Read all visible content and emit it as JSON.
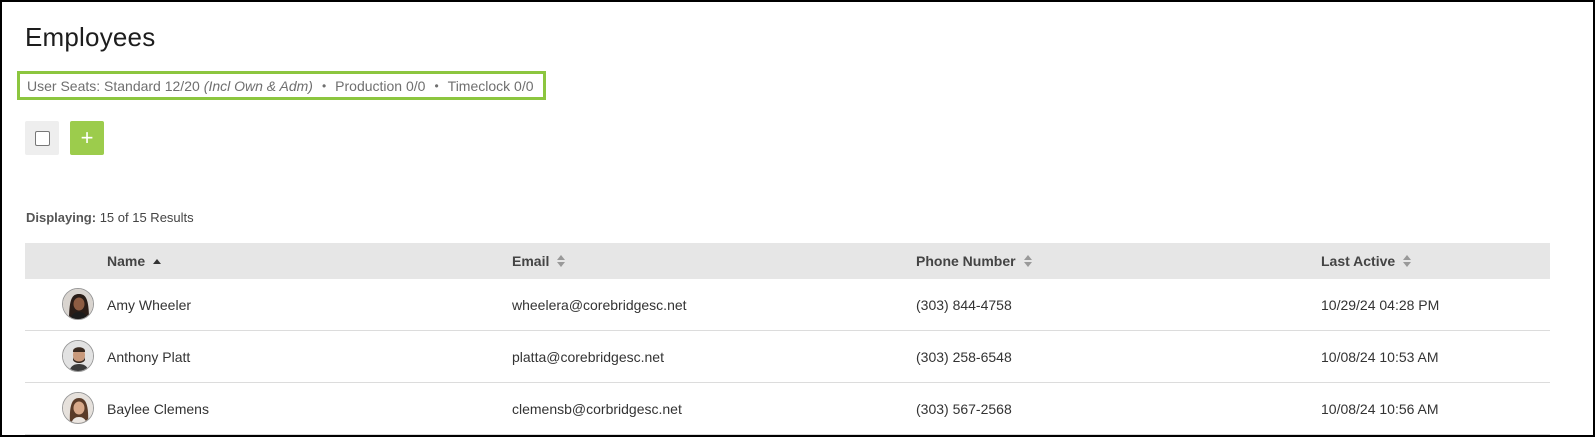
{
  "page": {
    "title": "Employees"
  },
  "seats": {
    "standard": "User Seats: Standard 12/20",
    "standard_note": "(Incl Own & Adm)",
    "separator": "•",
    "production": "Production 0/0",
    "timeclock": "Timeclock 0/0",
    "highlight_color": "#8cc63f"
  },
  "toolbar": {
    "add_label": "+",
    "add_color": "#9ccc4c"
  },
  "results": {
    "label": "Displaying:",
    "text": "15 of 15 Results"
  },
  "table": {
    "columns": [
      {
        "label": "Name",
        "sort": "ascending"
      },
      {
        "label": "Email",
        "sort": "none"
      },
      {
        "label": "Phone Number",
        "sort": "none"
      },
      {
        "label": "Last Active",
        "sort": "none"
      }
    ],
    "rows": [
      {
        "name": "Amy Wheeler",
        "email": "wheelera@corebridgesc.net",
        "phone": "(303) 844-4758",
        "last_active": "10/29/24 04:28 PM",
        "avatar": "photo-woman-dark-hair"
      },
      {
        "name": "Anthony Platt",
        "email": "platta@corebridgesc.net",
        "phone": "(303) 258-6548",
        "last_active": "10/08/24 10:53 AM",
        "avatar": "photo-man-beard"
      },
      {
        "name": "Baylee Clemens",
        "email": "clemensb@corbridgesc.net",
        "phone": "(303) 567-2568",
        "last_active": "10/08/24 10:56 AM",
        "avatar": "photo-woman-long-hair"
      }
    ]
  }
}
